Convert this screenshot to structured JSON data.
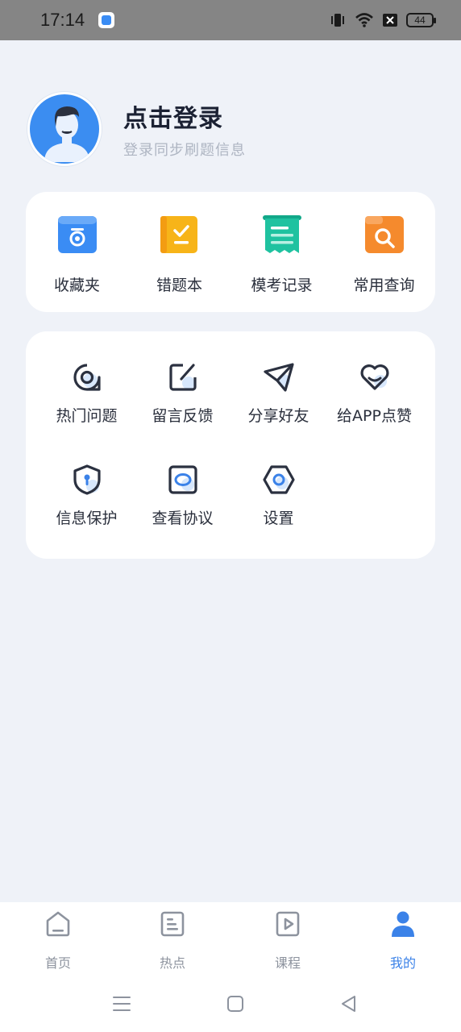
{
  "status_bar": {
    "time": "17:14",
    "battery_level": "44",
    "icons": [
      "app-notification-icon",
      "vibrate-icon",
      "wifi-icon",
      "close-box-icon",
      "battery-icon"
    ]
  },
  "profile": {
    "title": "点击登录",
    "subtitle": "登录同步刷题信息"
  },
  "tools": [
    {
      "label": "收藏夹",
      "icon": "favorites-folder-icon",
      "color": "#3a8cf4"
    },
    {
      "label": "错题本",
      "icon": "wrong-questions-book-icon",
      "color": "#f7b419"
    },
    {
      "label": "模考记录",
      "icon": "exam-record-icon",
      "color": "#1fc2a0"
    },
    {
      "label": "常用查询",
      "icon": "search-folder-icon",
      "color": "#f58a2d"
    }
  ],
  "more": [
    {
      "label": "热门问题",
      "icon": "hot-questions-icon"
    },
    {
      "label": "留言反馈",
      "icon": "feedback-edit-icon"
    },
    {
      "label": "分享好友",
      "icon": "share-paper-plane-icon"
    },
    {
      "label": "给APP点赞",
      "icon": "heart-like-icon"
    },
    {
      "label": "信息保护",
      "icon": "shield-lock-icon"
    },
    {
      "label": "查看协议",
      "icon": "agreement-icon"
    },
    {
      "label": "设置",
      "icon": "settings-hexagon-icon"
    }
  ],
  "bottom_nav": [
    {
      "label": "首页",
      "icon": "home-icon",
      "active": false
    },
    {
      "label": "热点",
      "icon": "hot-news-icon",
      "active": false
    },
    {
      "label": "课程",
      "icon": "course-play-icon",
      "active": false
    },
    {
      "label": "我的",
      "icon": "profile-icon",
      "active": true
    }
  ],
  "system_nav": [
    "menu-icon",
    "home-square-icon",
    "back-triangle-icon"
  ],
  "colors": {
    "accent": "#3b82e8",
    "background": "#eff2f8",
    "card": "#ffffff"
  }
}
